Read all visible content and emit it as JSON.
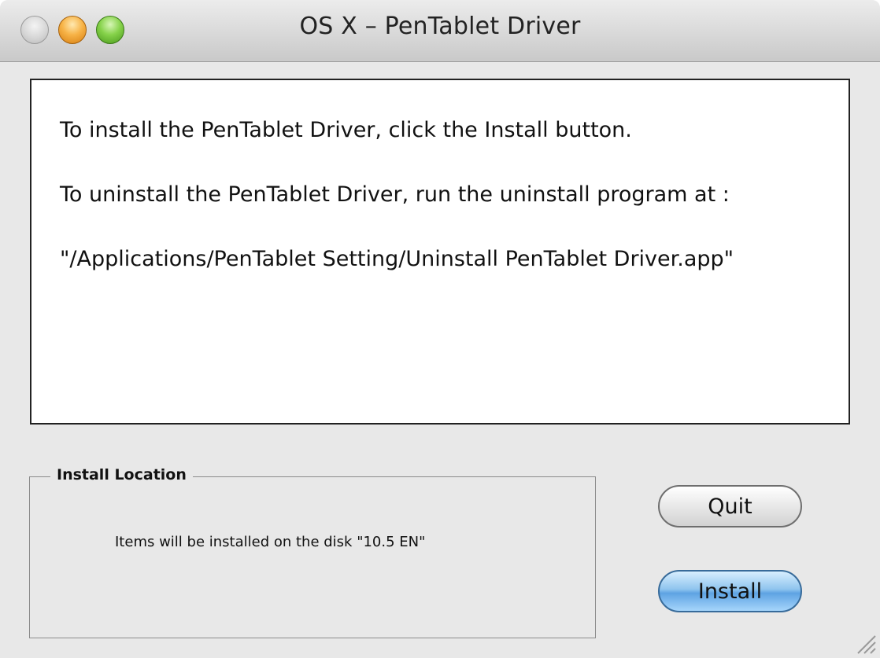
{
  "window": {
    "title": "OS X – PenTablet Driver"
  },
  "message": {
    "line1": "To install the PenTablet Driver, click the Install button.",
    "line2": "To uninstall the PenTablet Driver, run the uninstall program at :",
    "line3": "\"/Applications/PenTablet Setting/Uninstall PenTablet Driver.app\""
  },
  "install_location": {
    "label": "Install Location",
    "text": "Items will be installed on the disk \"10.5 EN\""
  },
  "buttons": {
    "quit": "Quit",
    "install": "Install"
  },
  "icons": {
    "close": "close-icon",
    "minimize": "minimize-icon",
    "zoom": "zoom-icon",
    "resize": "resize-grip-icon"
  },
  "colors": {
    "install_button": "#5ea3e3",
    "minimize": "#f7b347",
    "zoom": "#86d24a"
  }
}
